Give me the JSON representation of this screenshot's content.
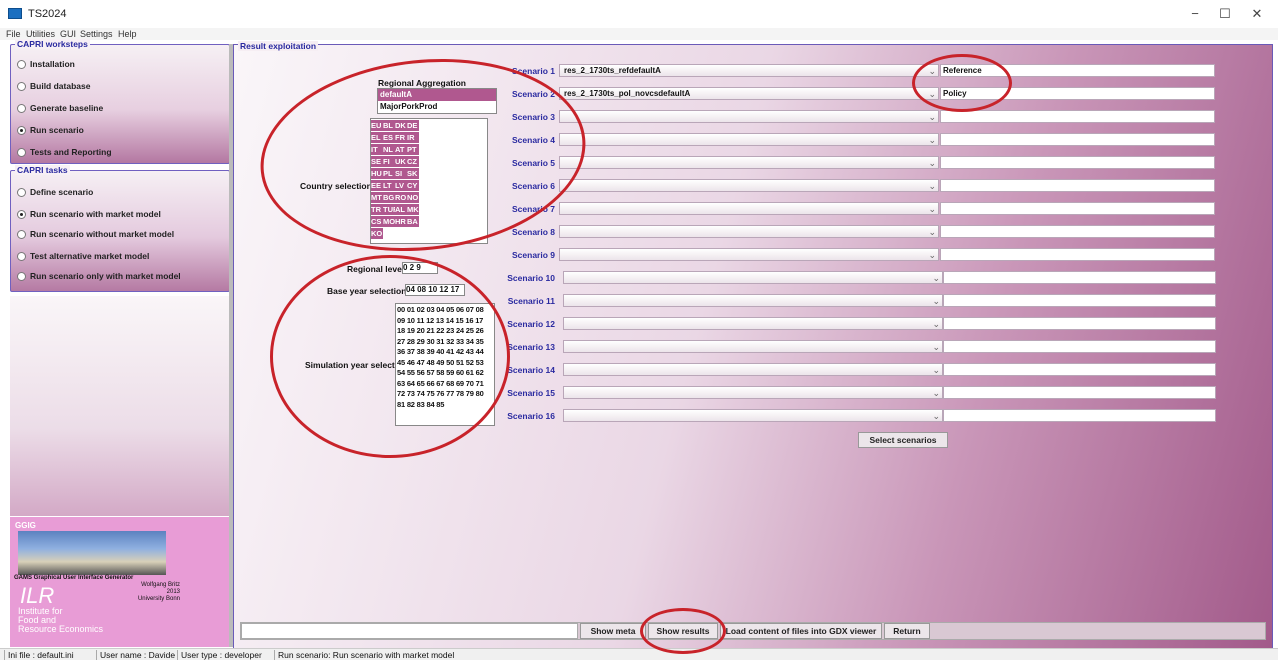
{
  "window": {
    "title": "TS2024",
    "minimize": "−",
    "maximize": "☐",
    "close": "✕"
  },
  "menu": [
    "File",
    "Utilities",
    "GUI",
    "Settings",
    "Help"
  ],
  "worksteps": {
    "title": "CAPRI worksteps",
    "items": [
      {
        "label": "Installation",
        "selected": false
      },
      {
        "label": "Build database",
        "selected": false
      },
      {
        "label": "Generate baseline",
        "selected": false
      },
      {
        "label": "Run scenario",
        "selected": true
      },
      {
        "label": "Tests and Reporting",
        "selected": false
      }
    ]
  },
  "tasks": {
    "title": "CAPRI tasks",
    "items": [
      {
        "label": "Define scenario",
        "selected": false
      },
      {
        "label": "Run scenario with market model",
        "selected": true
      },
      {
        "label": "Run scenario without market model",
        "selected": false
      },
      {
        "label": "Test alternative market model",
        "selected": false
      },
      {
        "label": "Run scenario only with market model",
        "selected": false
      }
    ]
  },
  "logo": {
    "label": "GGIG",
    "title": "GAMS Graphical User Interface Generator",
    "author": "Wolfgang Britz",
    "year": "2013",
    "university": "University Bonn",
    "ilr": "ILR",
    "institute": [
      "Institute for",
      "Food and",
      "Resource Economics"
    ]
  },
  "main": {
    "title": "Result exploitation"
  },
  "regional": {
    "label": "Regional Aggregation",
    "items": [
      {
        "label": "defaultA",
        "selected": true
      },
      {
        "label": "MajorPorkProd",
        "selected": false
      }
    ]
  },
  "country": {
    "label": "Country selection",
    "rows": [
      [
        "EU",
        "BL",
        "DK",
        "DE"
      ],
      [
        "EL",
        "ES",
        "FR",
        "IR"
      ],
      [
        "IT",
        "NL",
        "AT",
        "PT"
      ],
      [
        "SE",
        "FI",
        "UK",
        "CZ"
      ],
      [
        "HU",
        "PL",
        "SI",
        "SK"
      ],
      [
        "EE",
        "LT",
        "LV",
        "CY"
      ],
      [
        "MT",
        "BG",
        "RO",
        "NO"
      ],
      [
        "TR",
        "TUR",
        "AL",
        "MK"
      ],
      [
        "CS",
        "MO",
        "HR",
        "BA"
      ],
      [
        "KO"
      ]
    ]
  },
  "regional_level": {
    "label": "Regional level",
    "value": "0 2 9"
  },
  "base_year": {
    "label": "Base year selection",
    "value": "04 08 10 12 17"
  },
  "sim_year": {
    "label": "Simulation year selection",
    "lines": [
      "00 01 02 03 04 05 06 07 08",
      "09 10 11 12 13 14 15 16 17",
      "18 19 20 21 22 23 24 25 26",
      "27 28 29 30 31 32 33 34 35",
      "36 37 38 39 40 41 42 43 44",
      "45 46 47 48 49 50 51 52 53",
      "54 55 56 57 58 59 60 61 62",
      "63 64 65 66 67 68 69 70 71",
      "72 73 74 75 76 77 78 79 80",
      "81 82 83 84 85"
    ]
  },
  "scenarios": [
    {
      "label": "Scenario 1",
      "value": "res_2_1730ts_refdefaultA",
      "name": "Reference"
    },
    {
      "label": "Scenario 2",
      "value": "res_2_1730ts_pol_novcsdefaultA",
      "name": "Policy"
    },
    {
      "label": "Scenario 3",
      "value": "",
      "name": ""
    },
    {
      "label": "Scenario 4",
      "value": "",
      "name": ""
    },
    {
      "label": "Scenario 5",
      "value": "",
      "name": ""
    },
    {
      "label": "Scenario 6",
      "value": "",
      "name": ""
    },
    {
      "label": "Scenario 7",
      "value": "",
      "name": ""
    },
    {
      "label": "Scenario 8",
      "value": "",
      "name": ""
    },
    {
      "label": "Scenario 9",
      "value": "",
      "name": ""
    },
    {
      "label": "Scenario 10",
      "value": "",
      "name": ""
    },
    {
      "label": "Scenario 11",
      "value": "",
      "name": ""
    },
    {
      "label": "Scenario 12",
      "value": "",
      "name": ""
    },
    {
      "label": "Scenario 13",
      "value": "",
      "name": ""
    },
    {
      "label": "Scenario 14",
      "value": "",
      "name": ""
    },
    {
      "label": "Scenario 15",
      "value": "",
      "name": ""
    },
    {
      "label": "Scenario 16",
      "value": "",
      "name": ""
    }
  ],
  "buttons": {
    "select_scenarios": "Select scenarios",
    "show_meta": "Show meta",
    "show_results": "Show results",
    "load_gdx": "Load content of files into GDX viewer",
    "return": "Return"
  },
  "status": [
    "Ini file : default.ini",
    "User name : Davide",
    "User type : developer",
    "Run scenario: Run scenario with market model"
  ]
}
